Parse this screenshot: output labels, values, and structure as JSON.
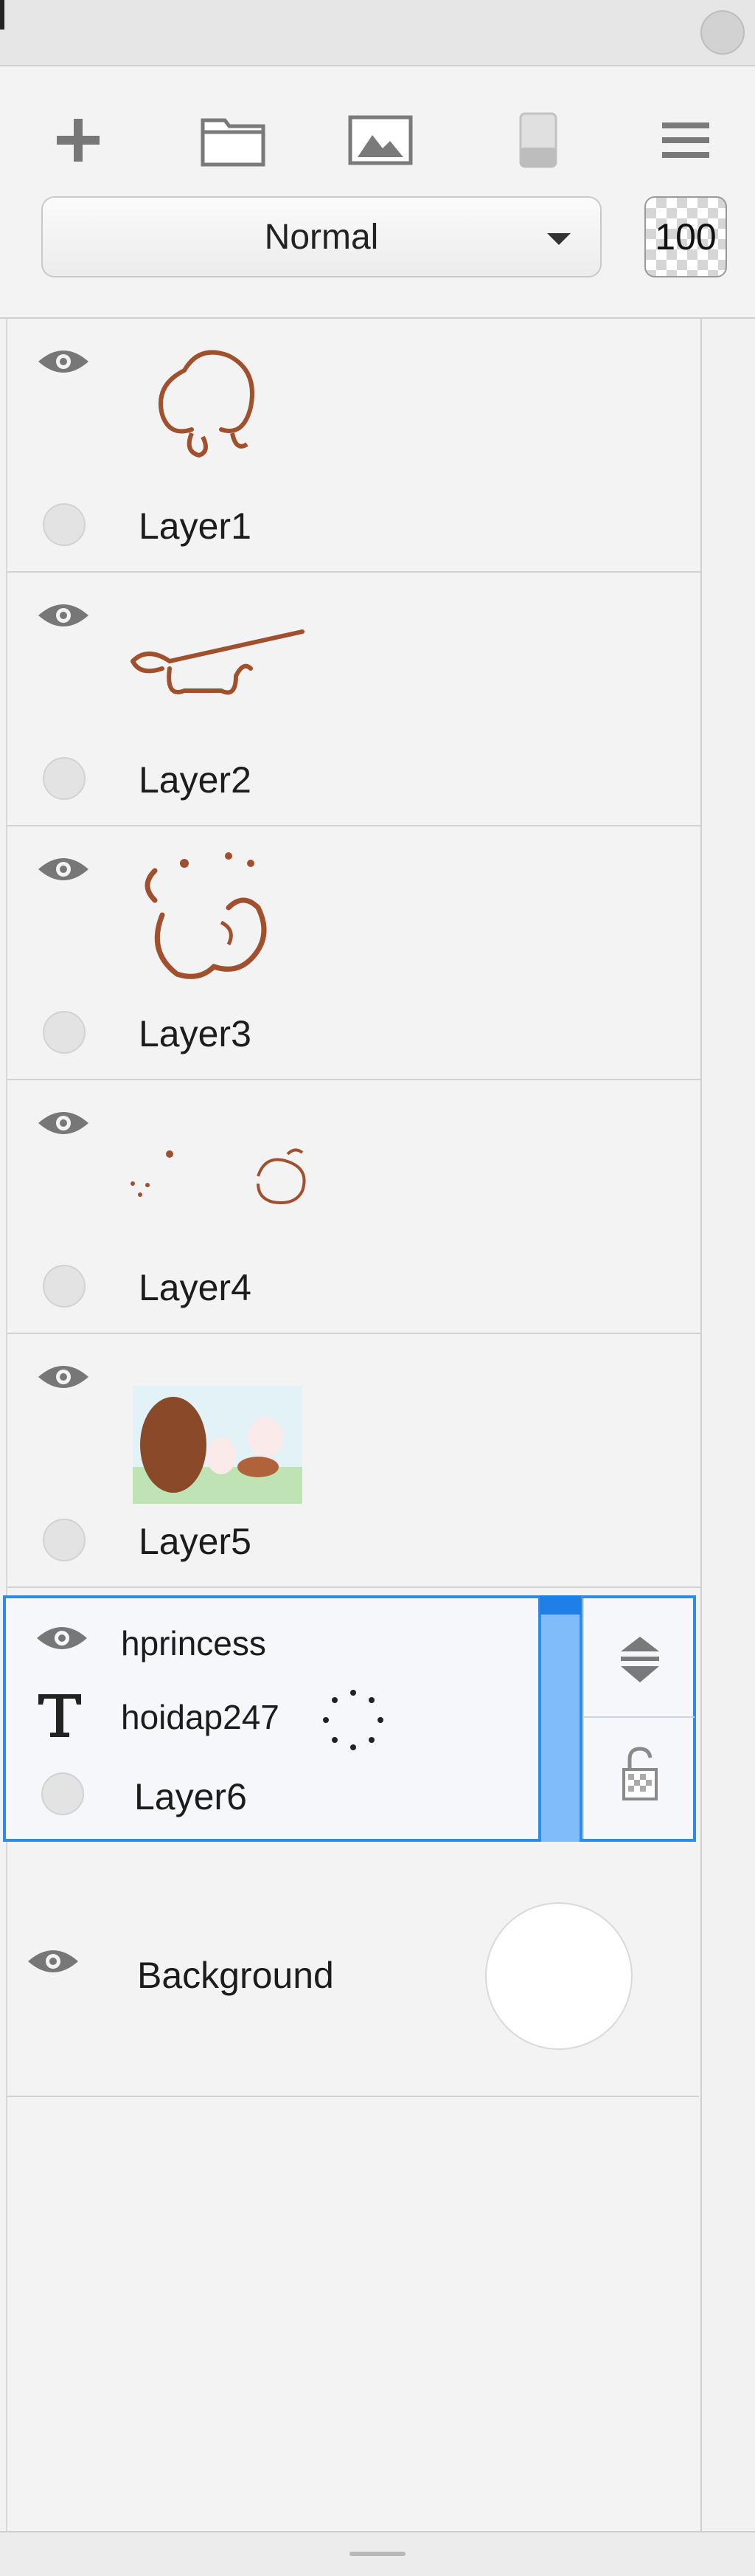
{
  "toolbar": {
    "add_icon": "plus-icon",
    "folder_icon": "folder-icon",
    "image_icon": "image-icon",
    "eraser_icon": "eraser-icon",
    "menu_icon": "menu-icon",
    "blend_mode": "Normal",
    "opacity": "100"
  },
  "layers": [
    {
      "name": "Layer1"
    },
    {
      "name": "Layer2"
    },
    {
      "name": "Layer3"
    },
    {
      "name": "Layer4"
    },
    {
      "name": "Layer5"
    }
  ],
  "active_layer": {
    "name": "Layer6",
    "line1": "hprincess",
    "line2": "hoidap247"
  },
  "background_layer": {
    "name": "Background"
  },
  "colors": {
    "accent": "#2f8bea",
    "accent_fill": "#80bcf9",
    "sketch": "#a0502d"
  }
}
